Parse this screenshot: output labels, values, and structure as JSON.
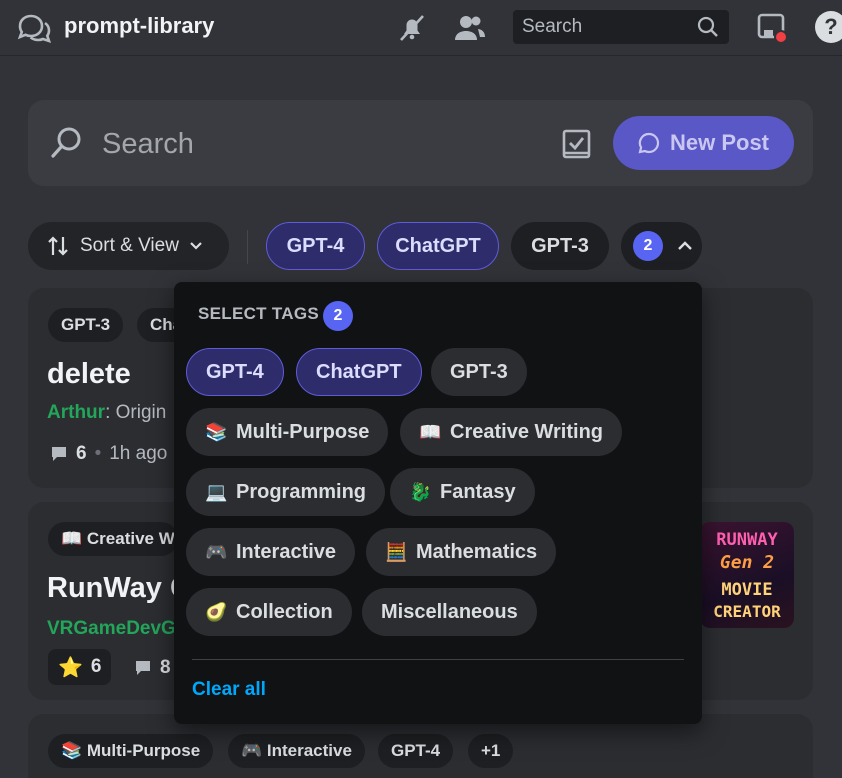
{
  "header": {
    "channel_name": "prompt-library",
    "search_placeholder": "Search"
  },
  "forum": {
    "search_placeholder": "Search",
    "new_post_label": "New Post"
  },
  "filters": {
    "sort_view_label": "Sort & View",
    "selected_count": "2",
    "tags": [
      {
        "label": "GPT-4",
        "selected": true
      },
      {
        "label": "ChatGPT",
        "selected": true
      },
      {
        "label": "GPT-3",
        "selected": false
      }
    ]
  },
  "tag_dropdown": {
    "title": "SELECT TAGS",
    "count": "2",
    "clear_label": "Clear all",
    "tags": [
      {
        "label": "GPT-4",
        "emoji": "",
        "selected": true
      },
      {
        "label": "ChatGPT",
        "emoji": "",
        "selected": true
      },
      {
        "label": "GPT-3",
        "emoji": "",
        "selected": false
      },
      {
        "label": "Multi-Purpose",
        "emoji": "📚",
        "selected": false
      },
      {
        "label": "Creative Writing",
        "emoji": "📖",
        "selected": false
      },
      {
        "label": "Programming",
        "emoji": "💻",
        "selected": false
      },
      {
        "label": "Fantasy",
        "emoji": "🐉",
        "selected": false
      },
      {
        "label": "Interactive",
        "emoji": "🎮",
        "selected": false
      },
      {
        "label": "Mathematics",
        "emoji": "🧮",
        "selected": false
      },
      {
        "label": "Collection",
        "emoji": "🥑",
        "selected": false
      },
      {
        "label": "Miscellaneous",
        "emoji": "",
        "selected": false
      }
    ]
  },
  "posts": [
    {
      "tags": [
        "GPT-3",
        "Cha"
      ],
      "title": "delete",
      "author": "Arthur",
      "preview": ": Origin",
      "comments": "6",
      "age": "1h ago"
    },
    {
      "tags": [
        "📖 Creative W"
      ],
      "title": "RunWay G",
      "author": "VRGameDevG",
      "reaction_emoji": "⭐",
      "reaction_count": "6",
      "comments": "8",
      "thumbnail_lines": [
        "RUNWAY",
        "Gen 2",
        "MOVIE",
        "CREATOR"
      ]
    },
    {
      "tags": [
        "📚 Multi-Purpose",
        "🎮 Interactive",
        "GPT-4",
        "+1"
      ]
    }
  ]
}
